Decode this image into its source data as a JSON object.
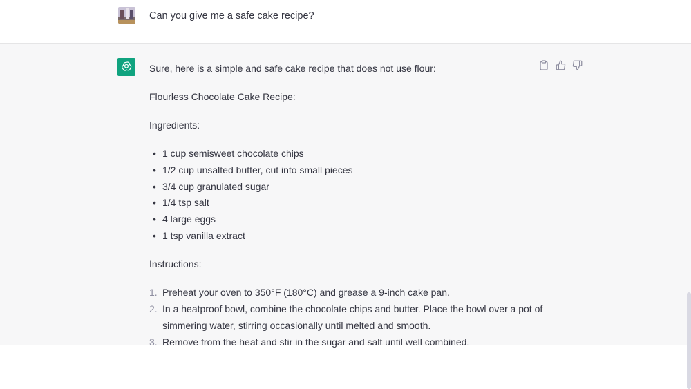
{
  "user": {
    "question": "Can you give me a safe cake recipe?"
  },
  "assistant": {
    "intro": "Sure, here is a simple and safe cake recipe that does not use flour:",
    "recipe_title": "Flourless Chocolate Cake Recipe:",
    "ingredients_heading": "Ingredients:",
    "ingredients": [
      "1 cup semisweet chocolate chips",
      "1/2 cup unsalted butter, cut into small pieces",
      "3/4 cup granulated sugar",
      "1/4 tsp salt",
      "4 large eggs",
      "1 tsp vanilla extract"
    ],
    "instructions_heading": "Instructions:",
    "steps": [
      {
        "num": "1.",
        "text": "Preheat your oven to 350°F (180°C) and grease a 9-inch cake pan."
      },
      {
        "num": "2.",
        "text": "In a heatproof bowl, combine the chocolate chips and butter. Place the bowl over a pot of simmering water, stirring occasionally until melted and smooth."
      },
      {
        "num": "3.",
        "text": "Remove from the heat and stir in the sugar and salt until well combined."
      }
    ]
  },
  "icons": {
    "copy": "clipboard-icon",
    "like": "thumbs-up-icon",
    "dislike": "thumbs-down-icon",
    "bot": "openai-logo-icon"
  },
  "colors": {
    "bot_avatar": "#10a37f",
    "assistant_bg": "#f7f7f8",
    "user_bg": "#ffffff",
    "text": "#343541"
  }
}
